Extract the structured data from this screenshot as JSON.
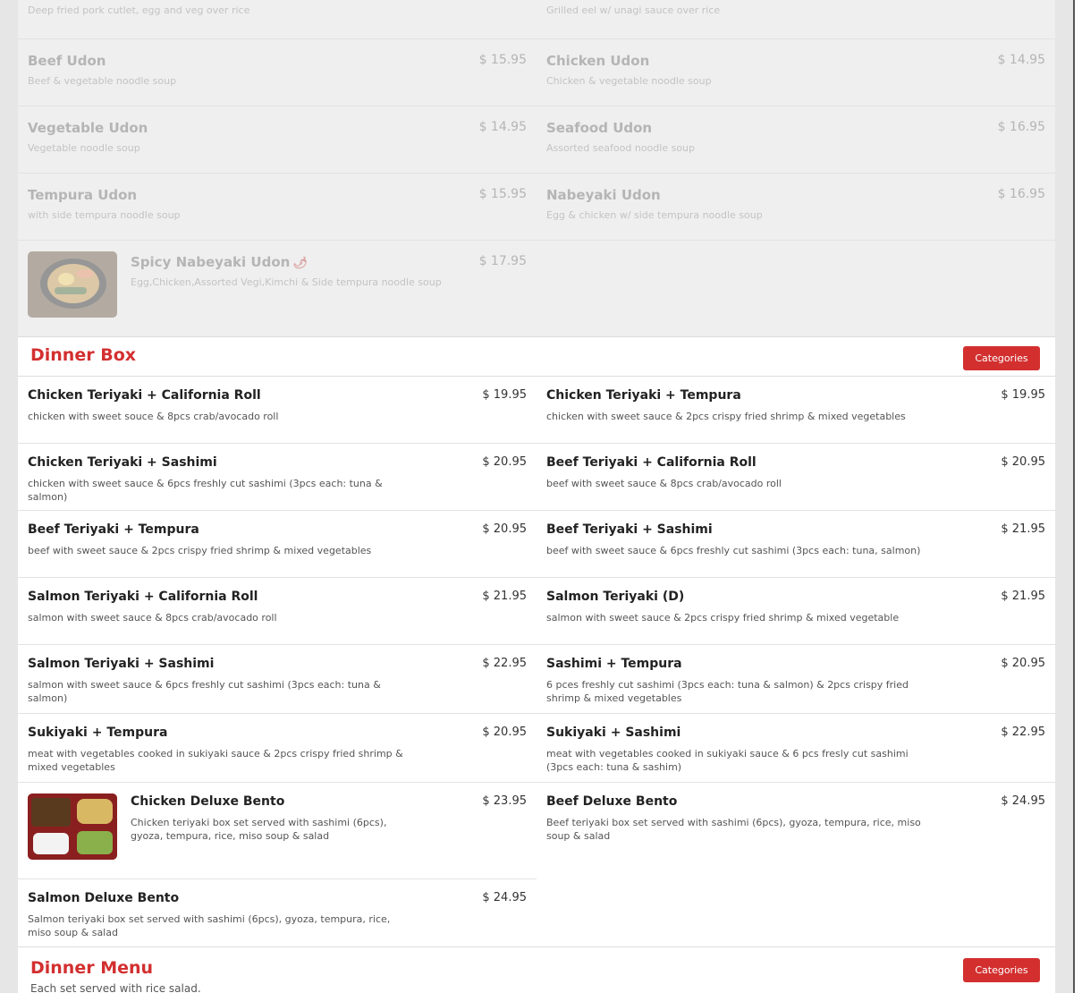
{
  "faded_section": {
    "left": [
      {
        "name": "",
        "desc": "Deep fried pork cutlet, egg and veg over rice",
        "price": ""
      },
      {
        "name": "Beef Udon",
        "desc": "Beef & vegetable noodle soup",
        "price": "$ 15.95"
      },
      {
        "name": "Vegetable Udon",
        "desc": "Vegetable noodle soup",
        "price": "$ 14.95"
      },
      {
        "name": "Tempura Udon",
        "desc": "with side tempura noodle soup",
        "price": "$ 15.95"
      },
      {
        "name": "Spicy Nabeyaki Udon",
        "desc": "Egg,Chicken,Assorted Vegi,Kimchi & Side tempura noodle soup",
        "price": "$ 17.95"
      }
    ],
    "right": [
      {
        "name": "",
        "desc": "Grilled eel w/ unagi sauce over rice",
        "price": ""
      },
      {
        "name": "Chicken Udon",
        "desc": "Chicken & vegetable noodle soup",
        "price": "$ 14.95"
      },
      {
        "name": "Seafood Udon",
        "desc": "Assorted seafood noodle soup",
        "price": "$ 16.95"
      },
      {
        "name": "Nabeyaki Udon",
        "desc": "Egg & chicken w/ side tempura noodle soup",
        "price": "$ 16.95"
      }
    ]
  },
  "dinner_box": {
    "title": "Dinner Box",
    "categories_label": "Categories",
    "left": [
      {
        "name": "Chicken Teriyaki + California Roll",
        "desc": "chicken with sweet souce & 8pcs crab/avocado roll",
        "price": "$ 19.95"
      },
      {
        "name": "Chicken Teriyaki + Sashimi",
        "desc": "chicken with sweet sauce & 6pcs freshly cut sashimi (3pcs each: tuna & salmon)",
        "price": "$ 20.95"
      },
      {
        "name": "Beef Teriyaki + Tempura",
        "desc": "beef with sweet sauce & 2pcs crispy fried shrimp & mixed vegetables",
        "price": "$ 20.95"
      },
      {
        "name": "Salmon Teriyaki + California Roll",
        "desc": "salmon with sweet sauce & 8pcs crab/avocado roll",
        "price": "$ 21.95"
      },
      {
        "name": "Salmon Teriyaki + Sashimi",
        "desc": "salmon with sweet sauce & 6pcs freshly cut sashimi (3pcs each: tuna & salmon)",
        "price": "$ 22.95"
      },
      {
        "name": "Sukiyaki + Tempura",
        "desc": "meat with vegetables cooked in sukiyaki sauce & 2pcs crispy fried shrimp & mixed vegetables",
        "price": "$ 20.95"
      },
      {
        "name": "Chicken Deluxe Bento",
        "desc": "Chicken teriyaki box set served with sashimi (6pcs), gyoza, tempura, rice, miso soup & salad",
        "price": "$ 23.95"
      },
      {
        "name": "Salmon Deluxe Bento",
        "desc": "Salmon teriyaki box set served with sashimi (6pcs), gyoza, tempura, rice, miso soup & salad",
        "price": "$ 24.95"
      }
    ],
    "right": [
      {
        "name": "Chicken Teriyaki + Tempura",
        "desc": "chicken with sweet sauce & 2pcs crispy fried shrimp & mixed vegetables",
        "price": "$ 19.95"
      },
      {
        "name": "Beef Teriyaki + California Roll",
        "desc": "beef with sweet sauce & 8pcs crab/avocado roll",
        "price": "$ 20.95"
      },
      {
        "name": "Beef Teriyaki + Sashimi",
        "desc": "beef with sweet sauce & 6pcs freshly cut sashimi (3pcs each: tuna, salmon)",
        "price": "$ 21.95"
      },
      {
        "name": "Salmon Teriyaki (D)",
        "desc": "salmon with sweet sauce & 2pcs crispy fried shrimp & mixed vegetable",
        "price": "$ 21.95"
      },
      {
        "name": "Sashimi + Tempura",
        "desc": "6 pces freshly cut sashimi (3pcs each: tuna & salmon) & 2pcs crispy fried shrimp & mixed vegetables",
        "price": "$ 20.95"
      },
      {
        "name": "Sukiyaki + Sashimi",
        "desc": "meat with vegetables cooked in sukiyaki sauce & 6 pcs fresly cut sashimi (3pcs each: tuna & sashim)",
        "price": "$ 22.95"
      },
      {
        "name": "Beef Deluxe Bento",
        "desc": "Beef teriyaki box set served with sashimi (6pcs), gyoza, tempura, rice, miso soup & salad",
        "price": "$ 24.95"
      }
    ]
  },
  "dinner_menu": {
    "title": "Dinner Menu",
    "categories_label": "Categories",
    "subtitle": "Each set served with rice salad."
  },
  "icons": {
    "chili": "chili-pepper-icon"
  },
  "colors": {
    "accent": "#d32f2f"
  }
}
